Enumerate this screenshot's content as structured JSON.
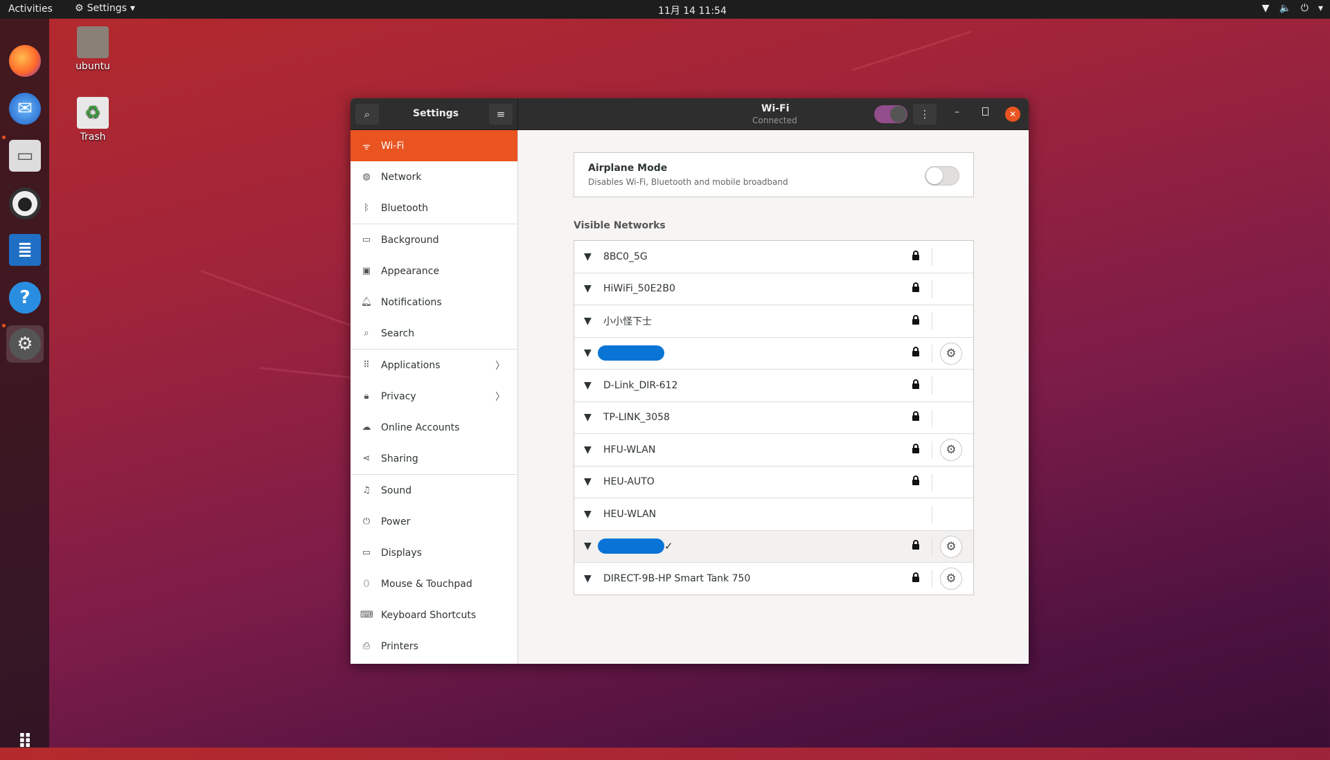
{
  "topbar": {
    "activities": "Activities",
    "app_menu": "Settings",
    "clock": "11月 14  11:54"
  },
  "desktop": {
    "items": [
      {
        "label": "ubuntu"
      },
      {
        "label": "Trash"
      }
    ]
  },
  "dock": {
    "items": [
      "firefox",
      "thunderbird",
      "files",
      "rhythmbox",
      "libreoffice-writer",
      "help",
      "settings"
    ],
    "show_apps": "show-applications"
  },
  "window": {
    "sidebar_title": "Settings",
    "page_title": "Wi-Fi",
    "page_subtitle": "Connected",
    "wifi_enabled": true
  },
  "sidebar": {
    "items": [
      {
        "label": "Wi-Fi",
        "icon": "wifi"
      },
      {
        "label": "Network",
        "icon": "globe"
      },
      {
        "label": "Bluetooth",
        "icon": "bluetooth"
      },
      {
        "label": "Background",
        "icon": "monitor"
      },
      {
        "label": "Appearance",
        "icon": "appearance"
      },
      {
        "label": "Notifications",
        "icon": "bell"
      },
      {
        "label": "Search",
        "icon": "search"
      },
      {
        "label": "Applications",
        "icon": "grid"
      },
      {
        "label": "Privacy",
        "icon": "lock"
      },
      {
        "label": "Online Accounts",
        "icon": "cloud"
      },
      {
        "label": "Sharing",
        "icon": "share"
      },
      {
        "label": "Sound",
        "icon": "music"
      },
      {
        "label": "Power",
        "icon": "power"
      },
      {
        "label": "Displays",
        "icon": "display"
      },
      {
        "label": "Mouse & Touchpad",
        "icon": "mouse"
      },
      {
        "label": "Keyboard Shortcuts",
        "icon": "keyboard"
      },
      {
        "label": "Printers",
        "icon": "printer"
      }
    ]
  },
  "airplane": {
    "title": "Airplane Mode",
    "subtitle": "Disables Wi-Fi, Bluetooth and mobile broadband",
    "enabled": false
  },
  "visible_networks": {
    "heading": "Visible Networks",
    "networks": [
      {
        "name": "8BC0_5G",
        "locked": true,
        "settings": false
      },
      {
        "name": "HiWiFi_50E2B0",
        "locked": true,
        "settings": false
      },
      {
        "name": "小小怪下士",
        "locked": true,
        "settings": false
      },
      {
        "name": "",
        "redacted": true,
        "locked": true,
        "settings": true
      },
      {
        "name": "D-Link_DIR-612",
        "locked": true,
        "settings": false
      },
      {
        "name": "TP-LINK_3058",
        "locked": true,
        "settings": false
      },
      {
        "name": "HFU-WLAN",
        "locked": true,
        "settings": true
      },
      {
        "name": "HEU-AUTO",
        "locked": true,
        "settings": false
      },
      {
        "name": "HEU-WLAN",
        "locked": false,
        "settings": false
      },
      {
        "name": "",
        "redacted": true,
        "connected": true,
        "locked": true,
        "settings": true
      },
      {
        "name": "DIRECT-9B-HP Smart Tank 750",
        "locked": true,
        "settings": true
      }
    ]
  },
  "colors": {
    "accent": "#e95420",
    "toggle_on": "#924d8b",
    "redaction": "#0a74d6"
  }
}
